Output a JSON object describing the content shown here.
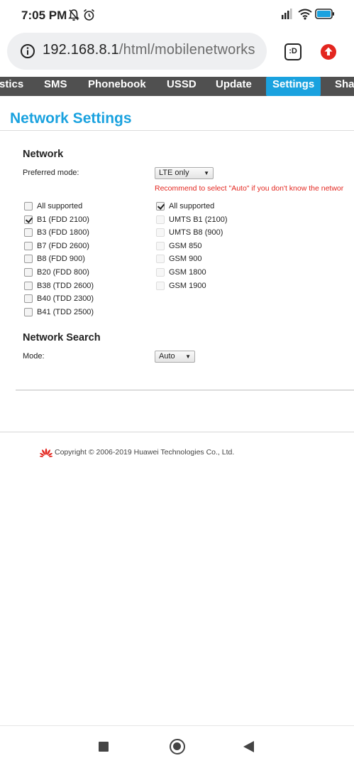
{
  "status_bar": {
    "time": "7:05 PM"
  },
  "browser": {
    "url_host": "192.168.8.1",
    "url_path": "/html/mobilenetworks",
    "tab_switcher_label": ":D"
  },
  "nav": {
    "items": [
      {
        "label": "stics"
      },
      {
        "label": "SMS"
      },
      {
        "label": "Phonebook"
      },
      {
        "label": "USSD"
      },
      {
        "label": "Update"
      },
      {
        "label": "Settings",
        "active": true
      },
      {
        "label": "Sha"
      }
    ]
  },
  "page": {
    "title": "Network Settings",
    "network": {
      "heading": "Network",
      "preferred_mode_label": "Preferred mode:",
      "preferred_mode_value": "LTE only",
      "recommendation": "Recommend to select \"Auto\" if you don't know the networ",
      "lte_bands": [
        {
          "label": "All supported",
          "checked": false
        },
        {
          "label": "B1 (FDD 2100)",
          "checked": true
        },
        {
          "label": "B3 (FDD 1800)",
          "checked": false
        },
        {
          "label": "B7 (FDD 2600)",
          "checked": false
        },
        {
          "label": "B8 (FDD 900)",
          "checked": false
        },
        {
          "label": "B20 (FDD 800)",
          "checked": false
        },
        {
          "label": "B38 (TDD 2600)",
          "checked": false
        },
        {
          "label": "B40 (TDD 2300)",
          "checked": false
        },
        {
          "label": "B41 (TDD 2500)",
          "checked": false
        }
      ],
      "other_bands": [
        {
          "label": "All supported",
          "checked": true
        },
        {
          "label": "UMTS B1 (2100)",
          "checked": false,
          "disabled": true
        },
        {
          "label": "UMTS B8 (900)",
          "checked": false,
          "disabled": true
        },
        {
          "label": "GSM 850",
          "checked": false,
          "disabled": true
        },
        {
          "label": "GSM 900",
          "checked": false,
          "disabled": true
        },
        {
          "label": "GSM 1800",
          "checked": false,
          "disabled": true
        },
        {
          "label": "GSM 1900",
          "checked": false,
          "disabled": true
        }
      ]
    },
    "network_search": {
      "heading": "Network Search",
      "mode_label": "Mode:",
      "mode_value": "Auto"
    }
  },
  "footer": {
    "copyright": "Copyright © 2006-2019 Huawei Technologies Co., Ltd."
  },
  "colors": {
    "accent": "#1aa2df",
    "nav_bg": "#505050",
    "warning": "#e3261f",
    "brand_red": "#e3261f"
  }
}
